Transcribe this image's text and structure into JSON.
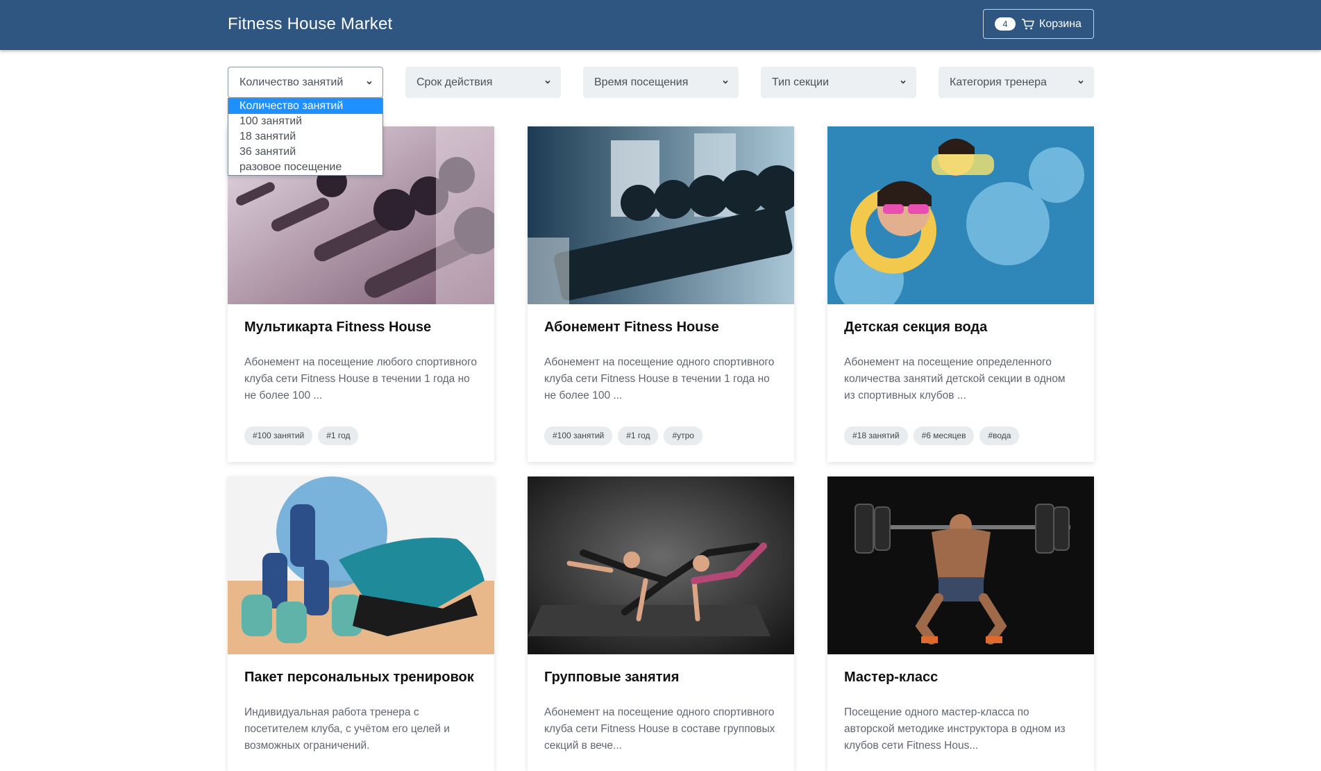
{
  "header": {
    "brand": "Fitness House Market",
    "cart_count": "4",
    "cart_label": "Корзина",
    "cart_icon": "shopping-cart-icon"
  },
  "filters": [
    {
      "label": "Количество занятий",
      "open": true
    },
    {
      "label": "Срок действия"
    },
    {
      "label": "Время посещения"
    },
    {
      "label": "Тип секции"
    },
    {
      "label": "Категория тренера"
    }
  ],
  "dropdown": {
    "options": [
      "Количество занятий",
      "100 занятий",
      "18 занятий",
      "36 занятий",
      "разовое посещение"
    ],
    "selected": "Количество занятий"
  },
  "products": [
    {
      "title": "Мультикарта Fitness House",
      "description": "Абонемент на посещение любого спортивного клуба сети Fitness House в течении 1 года но не более 100 ...",
      "tags": [
        "#100 занятий",
        "#1 год"
      ]
    },
    {
      "title": "Абонемент Fitness House",
      "description": "Абонемент на посещение одного спортивного клуба сети Fitness House в течении 1 года но не более 100 ...",
      "tags": [
        "#100 занятий",
        "#1 год",
        "#утро"
      ]
    },
    {
      "title": "Детская секция вода",
      "description": "Абонемент на посещение определенного количества занятий детской секции в одном из спортивных клубов ...",
      "tags": [
        "#18 занятий",
        "#6 месяцев",
        "#вода"
      ]
    },
    {
      "title": "Пакет персональных тренировок",
      "description": "Индивидуальная работа тренера с посетителем клуба, с учётом его целей и возможных ограничений.",
      "tags": []
    },
    {
      "title": "Групповые занятия",
      "description": "Абонемент на посещение одного спортивного клуба сети Fitness House в составе групповых секций в вече...",
      "tags": []
    },
    {
      "title": "Мастер-класс",
      "description": "Посещение одного мастер-класса по авторской методике инструктора в одном из клубов сети Fitness Hous...",
      "tags": []
    }
  ],
  "colors": {
    "navbar": "#2f5680",
    "selected_option": "#1e90ff",
    "filter_bg": "#edf0f3"
  }
}
